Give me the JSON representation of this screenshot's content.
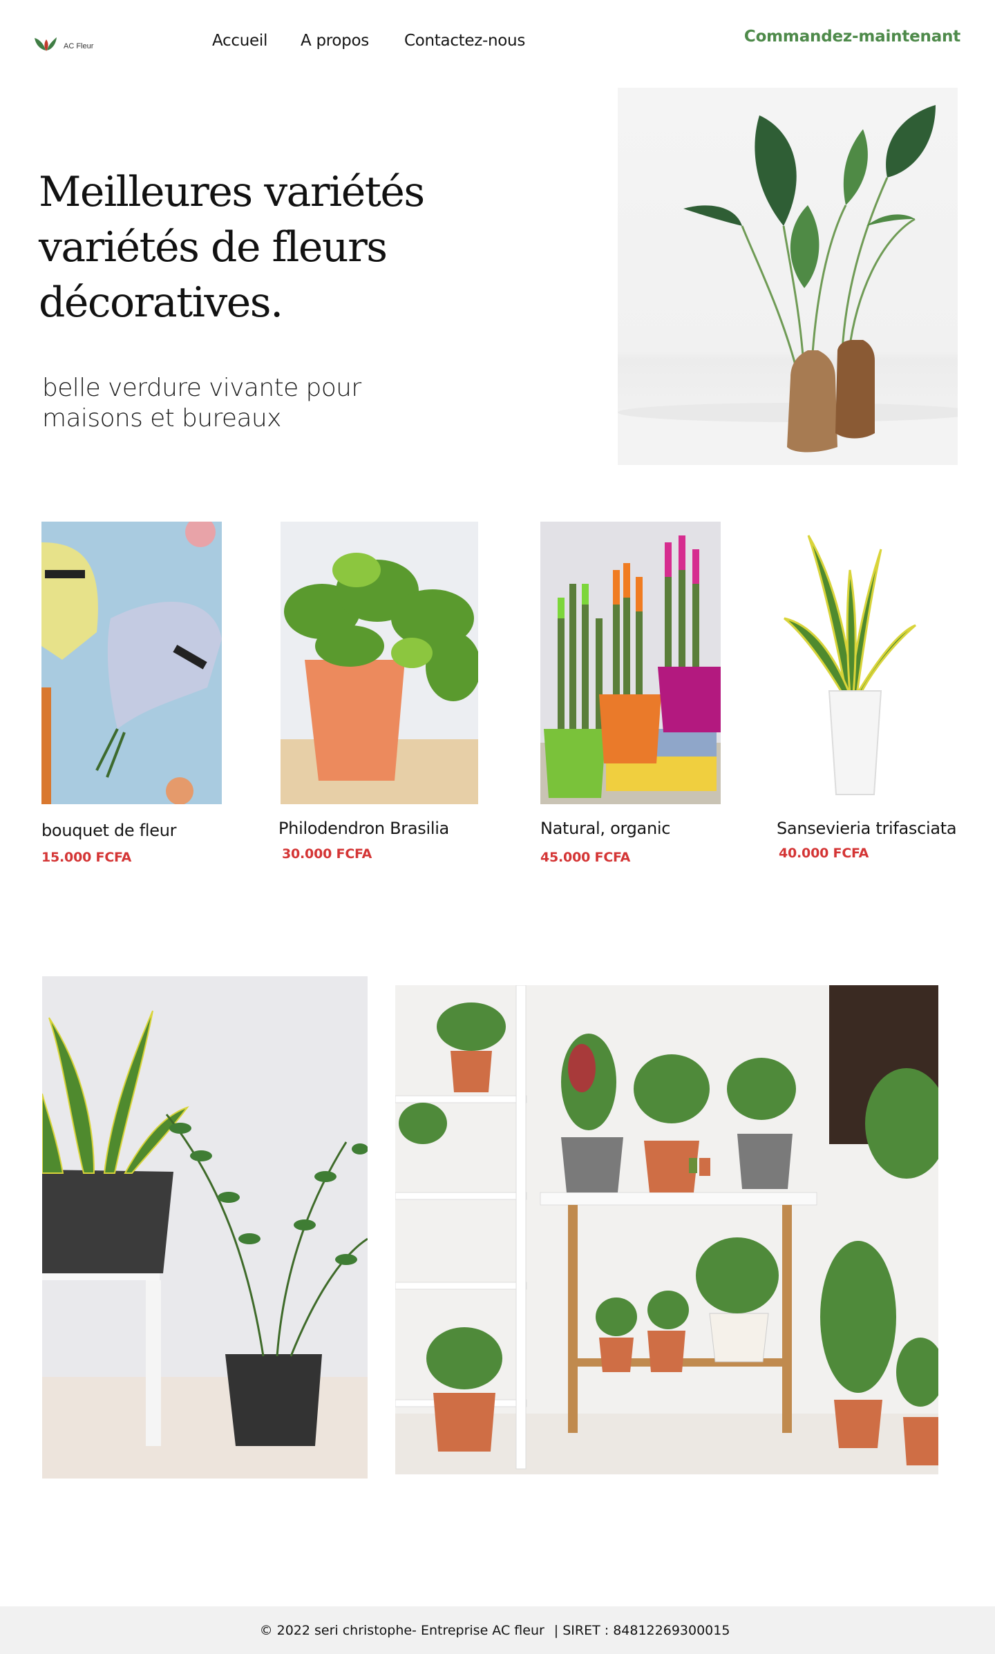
{
  "header": {
    "logo_text": "AC Fleur",
    "nav": [
      "Accueil",
      "A propos",
      "Contactez-nous"
    ],
    "cta_label": "Commandez-maintenant"
  },
  "hero": {
    "title_line1": "Meilleures variétés",
    "title_line2": "variétés de fleurs",
    "title_highlight": "décoratives",
    "title_end": ".",
    "subtitle": "belle verdure vivante pour maisons et bureaux"
  },
  "products": [
    {
      "name": "bouquet de fleur",
      "price": "15.000 FCFA"
    },
    {
      "name": "Philodendron Brasilia",
      "price": "30.000 FCFA"
    },
    {
      "name": "Natural, organic",
      "price": "45.000 FCFA"
    },
    {
      "name": "Sansevieria trifasciata",
      "price": "40.000 FCFA"
    }
  ],
  "footer": {
    "copyright": "© 2022 seri christophe- Entreprise AC fleur",
    "siret": "| SIRET : 84812269300015"
  },
  "colors": {
    "accent_green": "#4e8a4a",
    "highlight_green": "#3f7d44",
    "price_red": "#d43535",
    "footer_bg": "#f1f1f1"
  }
}
